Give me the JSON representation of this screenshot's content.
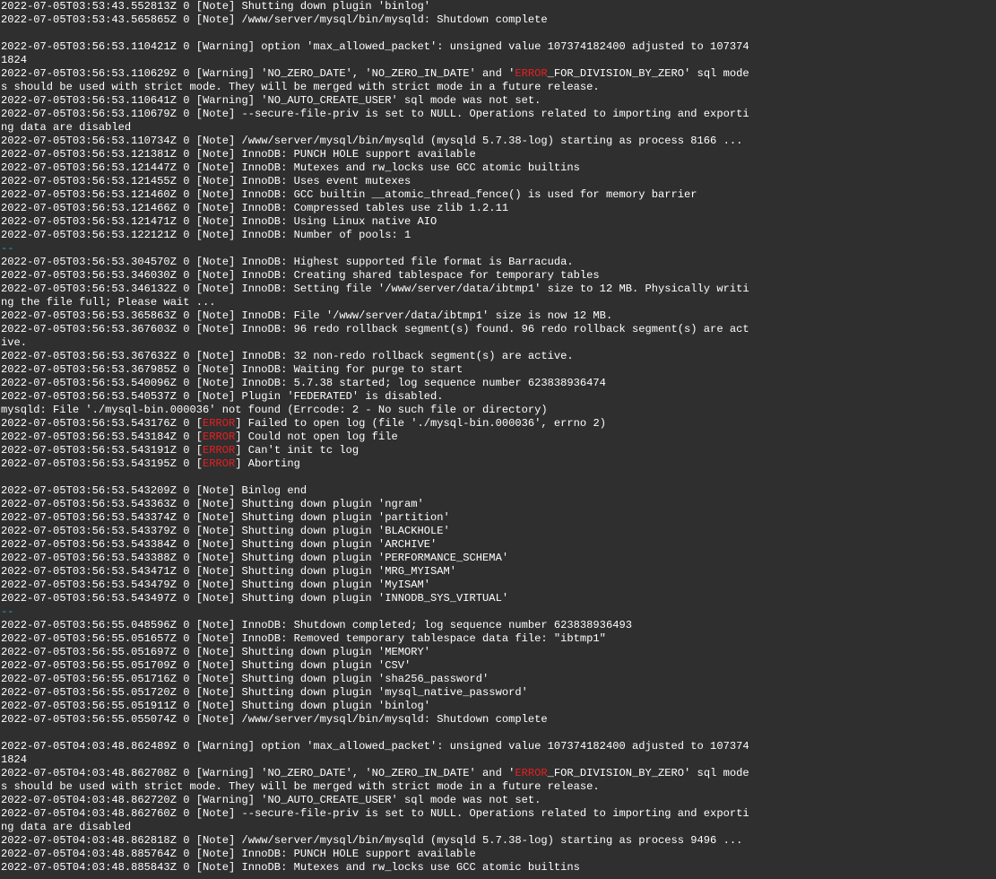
{
  "terminal": {
    "lines": [
      [
        "2022-07-05T03:53:43.552813Z 0 [Note] Shutting down plugin 'binlog'"
      ],
      [
        "2022-07-05T03:53:43.565865Z 0 [Note] /www/server/mysql/bin/mysqld: Shutdown complete"
      ],
      [
        ""
      ],
      [
        "2022-07-05T03:56:53.110421Z 0 [Warning] option 'max_allowed_packet': unsigned value 107374182400 adjusted to 107374"
      ],
      [
        "1824"
      ],
      [
        "2022-07-05T03:56:53.110629Z 0 [Warning] 'NO_ZERO_DATE', 'NO_ZERO_IN_DATE' and '",
        {
          "err": "ERROR"
        },
        "_FOR_DIVISION_BY_ZERO' sql mode"
      ],
      [
        "s should be used with strict mode. They will be merged with strict mode in a future release."
      ],
      [
        "2022-07-05T03:56:53.110641Z 0 [Warning] 'NO_AUTO_CREATE_USER' sql mode was not set."
      ],
      [
        "2022-07-05T03:56:53.110679Z 0 [Note] --secure-file-priv is set to NULL. Operations related to importing and exporti"
      ],
      [
        "ng data are disabled"
      ],
      [
        "2022-07-05T03:56:53.110734Z 0 [Note] /www/server/mysql/bin/mysqld (mysqld 5.7.38-log) starting as process 8166 ..."
      ],
      [
        "2022-07-05T03:56:53.121381Z 0 [Note] InnoDB: PUNCH HOLE support available"
      ],
      [
        "2022-07-05T03:56:53.121447Z 0 [Note] InnoDB: Mutexes and rw_locks use GCC atomic builtins"
      ],
      [
        "2022-07-05T03:56:53.121455Z 0 [Note] InnoDB: Uses event mutexes"
      ],
      [
        "2022-07-05T03:56:53.121460Z 0 [Note] InnoDB: GCC builtin __atomic_thread_fence() is used for memory barrier"
      ],
      [
        "2022-07-05T03:56:53.121466Z 0 [Note] InnoDB: Compressed tables use zlib 1.2.11"
      ],
      [
        "2022-07-05T03:56:53.121471Z 0 [Note] InnoDB: Using Linux native AIO"
      ],
      [
        "2022-07-05T03:56:53.122121Z 0 [Note] InnoDB: Number of pools: 1"
      ],
      [
        {
          "sep": "--"
        }
      ],
      [
        "2022-07-05T03:56:53.304570Z 0 [Note] InnoDB: Highest supported file format is Barracuda."
      ],
      [
        "2022-07-05T03:56:53.346030Z 0 [Note] InnoDB: Creating shared tablespace for temporary tables"
      ],
      [
        "2022-07-05T03:56:53.346132Z 0 [Note] InnoDB: Setting file '/www/server/data/ibtmp1' size to 12 MB. Physically writi"
      ],
      [
        "ng the file full; Please wait ..."
      ],
      [
        "2022-07-05T03:56:53.365863Z 0 [Note] InnoDB: File '/www/server/data/ibtmp1' size is now 12 MB."
      ],
      [
        "2022-07-05T03:56:53.367603Z 0 [Note] InnoDB: 96 redo rollback segment(s) found. 96 redo rollback segment(s) are act"
      ],
      [
        "ive."
      ],
      [
        "2022-07-05T03:56:53.367632Z 0 [Note] InnoDB: 32 non-redo rollback segment(s) are active."
      ],
      [
        "2022-07-05T03:56:53.367985Z 0 [Note] InnoDB: Waiting for purge to start"
      ],
      [
        "2022-07-05T03:56:53.540096Z 0 [Note] InnoDB: 5.7.38 started; log sequence number 623838936474"
      ],
      [
        "2022-07-05T03:56:53.540537Z 0 [Note] Plugin 'FEDERATED' is disabled."
      ],
      [
        "mysqld: File './mysql-bin.000036' not found (Errcode: 2 - No such file or directory)"
      ],
      [
        "2022-07-05T03:56:53.543176Z 0 [",
        {
          "err": "ERROR"
        },
        "] Failed to open log (file './mysql-bin.000036', errno 2)"
      ],
      [
        "2022-07-05T03:56:53.543184Z 0 [",
        {
          "err": "ERROR"
        },
        "] Could not open log file"
      ],
      [
        "2022-07-05T03:56:53.543191Z 0 [",
        {
          "err": "ERROR"
        },
        "] Can't init tc log"
      ],
      [
        "2022-07-05T03:56:53.543195Z 0 [",
        {
          "err": "ERROR"
        },
        "] Aborting"
      ],
      [
        ""
      ],
      [
        "2022-07-05T03:56:53.543209Z 0 [Note] Binlog end"
      ],
      [
        "2022-07-05T03:56:53.543363Z 0 [Note] Shutting down plugin 'ngram'"
      ],
      [
        "2022-07-05T03:56:53.543374Z 0 [Note] Shutting down plugin 'partition'"
      ],
      [
        "2022-07-05T03:56:53.543379Z 0 [Note] Shutting down plugin 'BLACKHOLE'"
      ],
      [
        "2022-07-05T03:56:53.543384Z 0 [Note] Shutting down plugin 'ARCHIVE'"
      ],
      [
        "2022-07-05T03:56:53.543388Z 0 [Note] Shutting down plugin 'PERFORMANCE_SCHEMA'"
      ],
      [
        "2022-07-05T03:56:53.543471Z 0 [Note] Shutting down plugin 'MRG_MYISAM'"
      ],
      [
        "2022-07-05T03:56:53.543479Z 0 [Note] Shutting down plugin 'MyISAM'"
      ],
      [
        "2022-07-05T03:56:53.543497Z 0 [Note] Shutting down plugin 'INNODB_SYS_VIRTUAL'"
      ],
      [
        {
          "sep": "--"
        }
      ],
      [
        "2022-07-05T03:56:55.048596Z 0 [Note] InnoDB: Shutdown completed; log sequence number 623838936493"
      ],
      [
        "2022-07-05T03:56:55.051657Z 0 [Note] InnoDB: Removed temporary tablespace data file: \"ibtmp1\""
      ],
      [
        "2022-07-05T03:56:55.051697Z 0 [Note] Shutting down plugin 'MEMORY'"
      ],
      [
        "2022-07-05T03:56:55.051709Z 0 [Note] Shutting down plugin 'CSV'"
      ],
      [
        "2022-07-05T03:56:55.051716Z 0 [Note] Shutting down plugin 'sha256_password'"
      ],
      [
        "2022-07-05T03:56:55.051720Z 0 [Note] Shutting down plugin 'mysql_native_password'"
      ],
      [
        "2022-07-05T03:56:55.051911Z 0 [Note] Shutting down plugin 'binlog'"
      ],
      [
        "2022-07-05T03:56:55.055074Z 0 [Note] /www/server/mysql/bin/mysqld: Shutdown complete"
      ],
      [
        ""
      ],
      [
        "2022-07-05T04:03:48.862489Z 0 [Warning] option 'max_allowed_packet': unsigned value 107374182400 adjusted to 107374"
      ],
      [
        "1824"
      ],
      [
        "2022-07-05T04:03:48.862708Z 0 [Warning] 'NO_ZERO_DATE', 'NO_ZERO_IN_DATE' and '",
        {
          "err": "ERROR"
        },
        "_FOR_DIVISION_BY_ZERO' sql mode"
      ],
      [
        "s should be used with strict mode. They will be merged with strict mode in a future release."
      ],
      [
        "2022-07-05T04:03:48.862720Z 0 [Warning] 'NO_AUTO_CREATE_USER' sql mode was not set."
      ],
      [
        "2022-07-05T04:03:48.862760Z 0 [Note] --secure-file-priv is set to NULL. Operations related to importing and exporti"
      ],
      [
        "ng data are disabled"
      ],
      [
        "2022-07-05T04:03:48.862818Z 0 [Note] /www/server/mysql/bin/mysqld (mysqld 5.7.38-log) starting as process 9496 ..."
      ],
      [
        "2022-07-05T04:03:48.885764Z 0 [Note] InnoDB: PUNCH HOLE support available"
      ],
      [
        "2022-07-05T04:03:48.885843Z 0 [Note] InnoDB: Mutexes and rw_locks use GCC atomic builtins"
      ]
    ]
  },
  "colors": {
    "background": "#2f2f2f",
    "text": "#ffffff",
    "error_highlight": "#e52020",
    "separator": "#21a1c4"
  }
}
